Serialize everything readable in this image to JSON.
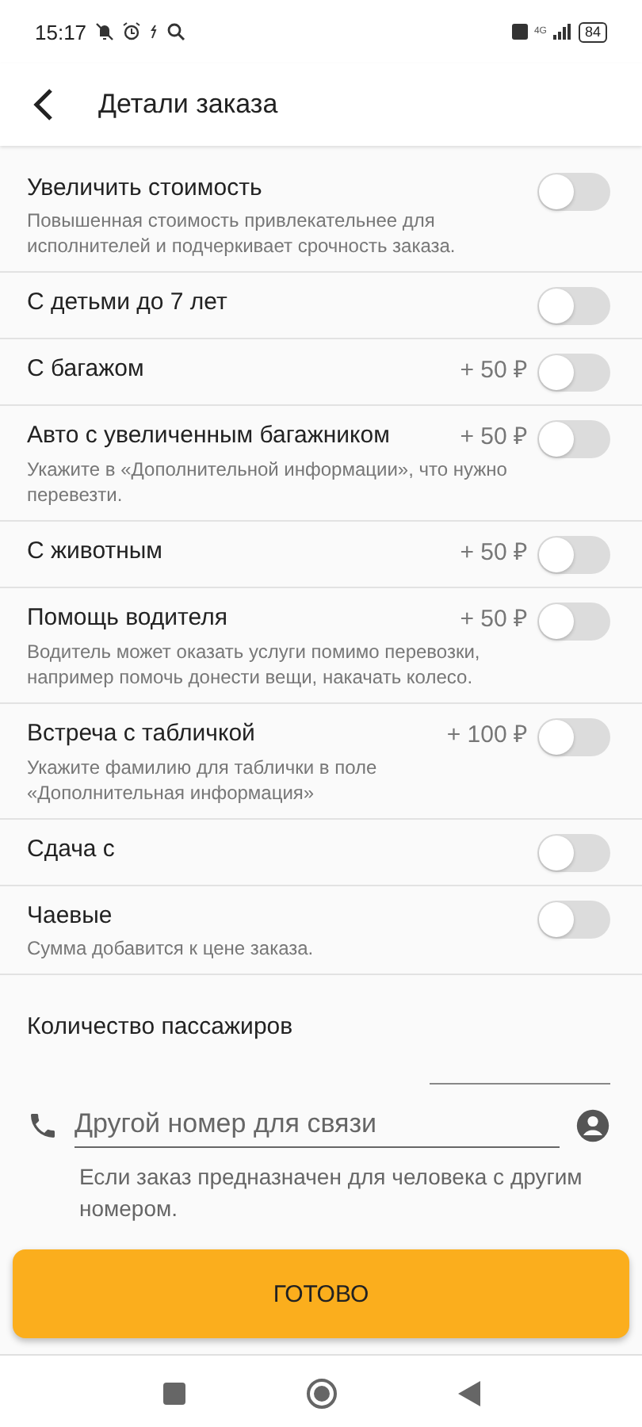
{
  "status_bar": {
    "time": "15:17",
    "network": "4G",
    "battery": "84"
  },
  "header": {
    "title": "Детали заказа"
  },
  "options": [
    {
      "title": "Увеличить стоимость",
      "description": "Повышенная стоимость привлекательнее для исполнителей и подчеркивает срочность заказа.",
      "on": false
    },
    {
      "title": "С детьми до 7 лет",
      "on": false
    },
    {
      "title": "С багажом",
      "price": "+ 50 ₽",
      "on": false
    },
    {
      "title": "Авто с увеличенным багажником",
      "price": "+ 50 ₽",
      "description": "Укажите в «Дополнительной информации», что нужно перевезти.",
      "on": false
    },
    {
      "title": "С животным",
      "price": "+ 50 ₽",
      "on": false
    },
    {
      "title": "Помощь водителя",
      "price": "+ 50 ₽",
      "description": "Водитель может оказать услуги помимо перевозки, например помочь донести вещи, накачать колесо.",
      "on": false
    },
    {
      "title": "Встреча с табличкой",
      "price": "+ 100 ₽",
      "description": "Укажите фамилию для таблички в поле «Дополнительная информация»",
      "on": false
    },
    {
      "title": "Сдача с",
      "on": false
    },
    {
      "title": "Чаевые",
      "description": "Сумма добавится к цене заказа.",
      "on": false
    }
  ],
  "passengers": {
    "label": "Количество пассажиров"
  },
  "contact": {
    "placeholder": "Другой номер для связи",
    "helper": "Если заказ предназначен для человека с другим номером."
  },
  "done_button": "ГОТОВО"
}
